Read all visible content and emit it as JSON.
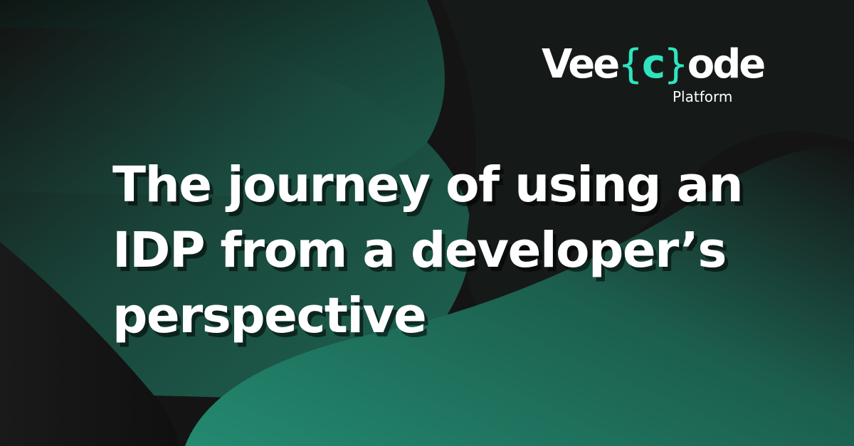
{
  "brand": {
    "name_part1": "Vee",
    "name_brace_open": "{",
    "name_letter": "c",
    "name_brace_close": "}",
    "name_part2": "ode",
    "subtitle": "Platform",
    "accent_color": "#2fe5bf"
  },
  "headline": {
    "lines": [
      "The journey of using an",
      "IDP from a developer’s",
      "perspective"
    ]
  },
  "colors": {
    "background": "#141414",
    "green_dark": "#17443a",
    "green_mid": "#1e6a57",
    "green_light": "#23856c",
    "text": "#ffffff"
  }
}
